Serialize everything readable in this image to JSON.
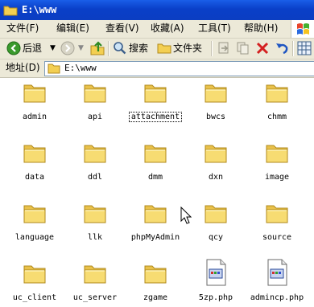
{
  "window": {
    "title": "E:\\www"
  },
  "menu": [
    "文件(F)",
    "编辑(E)",
    "查看(V)",
    "收藏(A)",
    "工具(T)",
    "帮助(H)"
  ],
  "toolbar": {
    "back_label": "后退",
    "search_label": "搜索",
    "folders_label": "文件夹"
  },
  "address": {
    "label": "地址(D)",
    "value": "E:\\www"
  },
  "items": [
    {
      "name": "admin",
      "kind": "folder"
    },
    {
      "name": "api",
      "kind": "folder"
    },
    {
      "name": "attachment",
      "kind": "folder",
      "focused": true
    },
    {
      "name": "bwcs",
      "kind": "folder"
    },
    {
      "name": "chmm",
      "kind": "folder"
    },
    {
      "name": "data",
      "kind": "folder"
    },
    {
      "name": "ddl",
      "kind": "folder"
    },
    {
      "name": "dmm",
      "kind": "folder"
    },
    {
      "name": "dxn",
      "kind": "folder"
    },
    {
      "name": "image",
      "kind": "folder"
    },
    {
      "name": "language",
      "kind": "folder"
    },
    {
      "name": "llk",
      "kind": "folder"
    },
    {
      "name": "phpMyAdmin",
      "kind": "folder"
    },
    {
      "name": "qcy",
      "kind": "folder"
    },
    {
      "name": "source",
      "kind": "folder"
    },
    {
      "name": "uc_client",
      "kind": "folder"
    },
    {
      "name": "uc_server",
      "kind": "folder"
    },
    {
      "name": "zgame",
      "kind": "folder"
    },
    {
      "name": "5zp.php",
      "kind": "php-file"
    },
    {
      "name": "admincp.php",
      "kind": "php-file"
    }
  ],
  "colors": {
    "title_bar": "#0b3ec2",
    "chrome": "#ece9d8",
    "folder": "#f5d669"
  }
}
